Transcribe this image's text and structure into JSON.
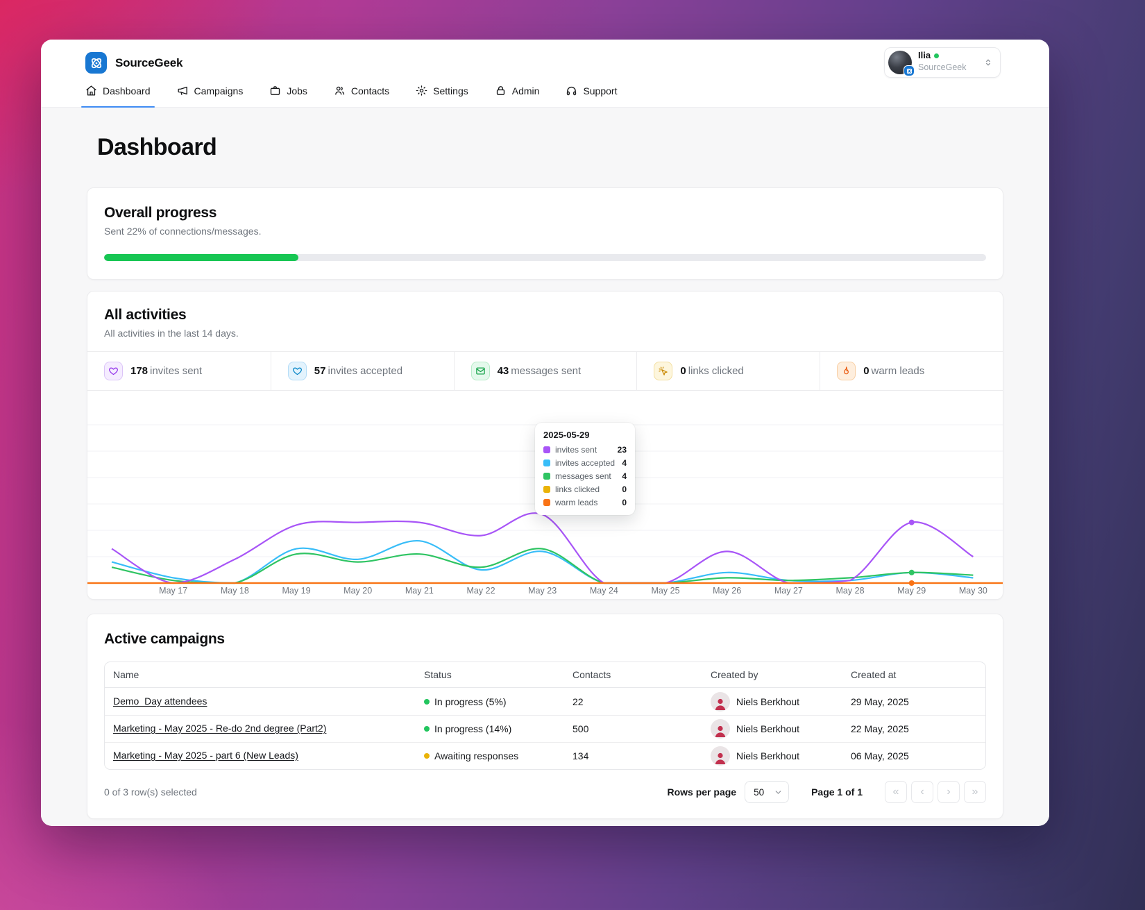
{
  "app": {
    "name": "SourceGeek"
  },
  "user_menu": {
    "name": "Ilia",
    "org": "SourceGeek",
    "online_color": "#22c55e"
  },
  "nav": {
    "items": [
      {
        "label": "Dashboard",
        "icon": "home",
        "active": true
      },
      {
        "label": "Campaigns",
        "icon": "megaphone",
        "active": false
      },
      {
        "label": "Jobs",
        "icon": "briefcase",
        "active": false
      },
      {
        "label": "Contacts",
        "icon": "users",
        "active": false
      },
      {
        "label": "Settings",
        "icon": "gear",
        "active": false
      },
      {
        "label": "Admin",
        "icon": "lock",
        "active": false
      },
      {
        "label": "Support",
        "icon": "headphones",
        "active": false
      }
    ]
  },
  "page": {
    "title": "Dashboard"
  },
  "overall_progress": {
    "title": "Overall progress",
    "subtitle": "Sent 22% of connections/messages.",
    "percent": 22,
    "bar_color": "#17c653"
  },
  "activities": {
    "title": "All activities",
    "subtitle": "All activities in the last 14 days.",
    "stats": [
      {
        "value": "178",
        "label": "invites sent",
        "icon": "invite-heart",
        "color": "#9333ea",
        "bg": "#f5ecff",
        "border": "#dcc5f8"
      },
      {
        "value": "57",
        "label": "invites accepted",
        "icon": "invite-heart",
        "color": "#0284c7",
        "bg": "#e3f3fd",
        "border": "#b5ddf7"
      },
      {
        "value": "43",
        "label": "messages sent",
        "icon": "mail-check",
        "color": "#16a34a",
        "bg": "#e4f9ec",
        "border": "#b7ecc8"
      },
      {
        "value": "0",
        "label": "links clicked",
        "icon": "cursor-click",
        "color": "#ca8a04",
        "bg": "#fdf6dd",
        "border": "#f3dfa0"
      },
      {
        "value": "0",
        "label": "warm leads",
        "icon": "flame",
        "color": "#ea580c",
        "bg": "#feeedd",
        "border": "#f8cfa4"
      }
    ]
  },
  "chart_data": {
    "type": "line",
    "title": "All activities in the last 14 days",
    "x": [
      "",
      "May 17",
      "May 18",
      "May 19",
      "May 20",
      "May 21",
      "May 22",
      "May 23",
      "May 24",
      "May 25",
      "May 26",
      "May 27",
      "May 28",
      "May 29",
      "May 30"
    ],
    "series": [
      {
        "name": "invites sent",
        "color": "#a855f7",
        "values": [
          13,
          0,
          9,
          22,
          23,
          23,
          18,
          26,
          0,
          0,
          12,
          0,
          1,
          23,
          10
        ]
      },
      {
        "name": "invites accepted",
        "color": "#38bdf8",
        "values": [
          8,
          2,
          0,
          13,
          9,
          16,
          5,
          12,
          0,
          0,
          4,
          1,
          1,
          4,
          2
        ]
      },
      {
        "name": "messages sent",
        "color": "#2fc463",
        "values": [
          6,
          1,
          0,
          11,
          8,
          11,
          6,
          13,
          0,
          0,
          2,
          1,
          2,
          4,
          3
        ]
      },
      {
        "name": "links clicked",
        "color": "#eab308",
        "values": [
          0,
          0,
          0,
          0,
          0,
          0,
          0,
          0,
          0,
          0,
          0,
          0,
          0,
          0,
          0
        ]
      },
      {
        "name": "warm leads",
        "color": "#f97316",
        "values": [
          0,
          0,
          0,
          0,
          0,
          0,
          0,
          0,
          0,
          0,
          0,
          0,
          0,
          0,
          0
        ]
      }
    ],
    "ylim": [
      0,
      60
    ],
    "grid": "horizontal",
    "legend": "tooltip-only",
    "hover": {
      "index": 13,
      "dot_series": [
        0,
        2,
        4
      ]
    },
    "tooltip": {
      "title": "2025-05-29",
      "rows": [
        {
          "label": "invites sent",
          "value": "23",
          "color": "#a855f7"
        },
        {
          "label": "invites accepted",
          "value": "4",
          "color": "#38bdf8"
        },
        {
          "label": "messages sent",
          "value": "4",
          "color": "#2fc463"
        },
        {
          "label": "links clicked",
          "value": "0",
          "color": "#eab308"
        },
        {
          "label": "warm leads",
          "value": "0",
          "color": "#f97316"
        }
      ]
    }
  },
  "campaigns": {
    "title": "Active campaigns",
    "columns": [
      "Name",
      "Status",
      "Contacts",
      "Created by",
      "Created at"
    ],
    "rows": [
      {
        "name": "Demo_Day attendees",
        "status": "In progress (5%)",
        "status_color": "#22c55e",
        "contacts": "22",
        "created_by": "Niels Berkhout",
        "created_at": "29 May, 2025"
      },
      {
        "name": "Marketing - May 2025 - Re-do 2nd degree (Part2)",
        "status": "In progress (14%)",
        "status_color": "#22c55e",
        "contacts": "500",
        "created_by": "Niels Berkhout",
        "created_at": "22 May, 2025"
      },
      {
        "name": "Marketing - May 2025 - part 6 (New Leads)",
        "status": "Awaiting responses",
        "status_color": "#eab308",
        "contacts": "134",
        "created_by": "Niels Berkhout",
        "created_at": "06 May, 2025"
      }
    ],
    "footer": {
      "selected": "0 of 3 row(s) selected",
      "rows_per_page_label": "Rows per page",
      "rows_per_page": "50",
      "page_label": "Page 1 of 1",
      "pagination": [
        {
          "name": "first-page",
          "glyph": "«"
        },
        {
          "name": "prev-page",
          "glyph": "‹"
        },
        {
          "name": "next-page",
          "glyph": "›"
        },
        {
          "name": "last-page",
          "glyph": "»"
        }
      ]
    }
  }
}
